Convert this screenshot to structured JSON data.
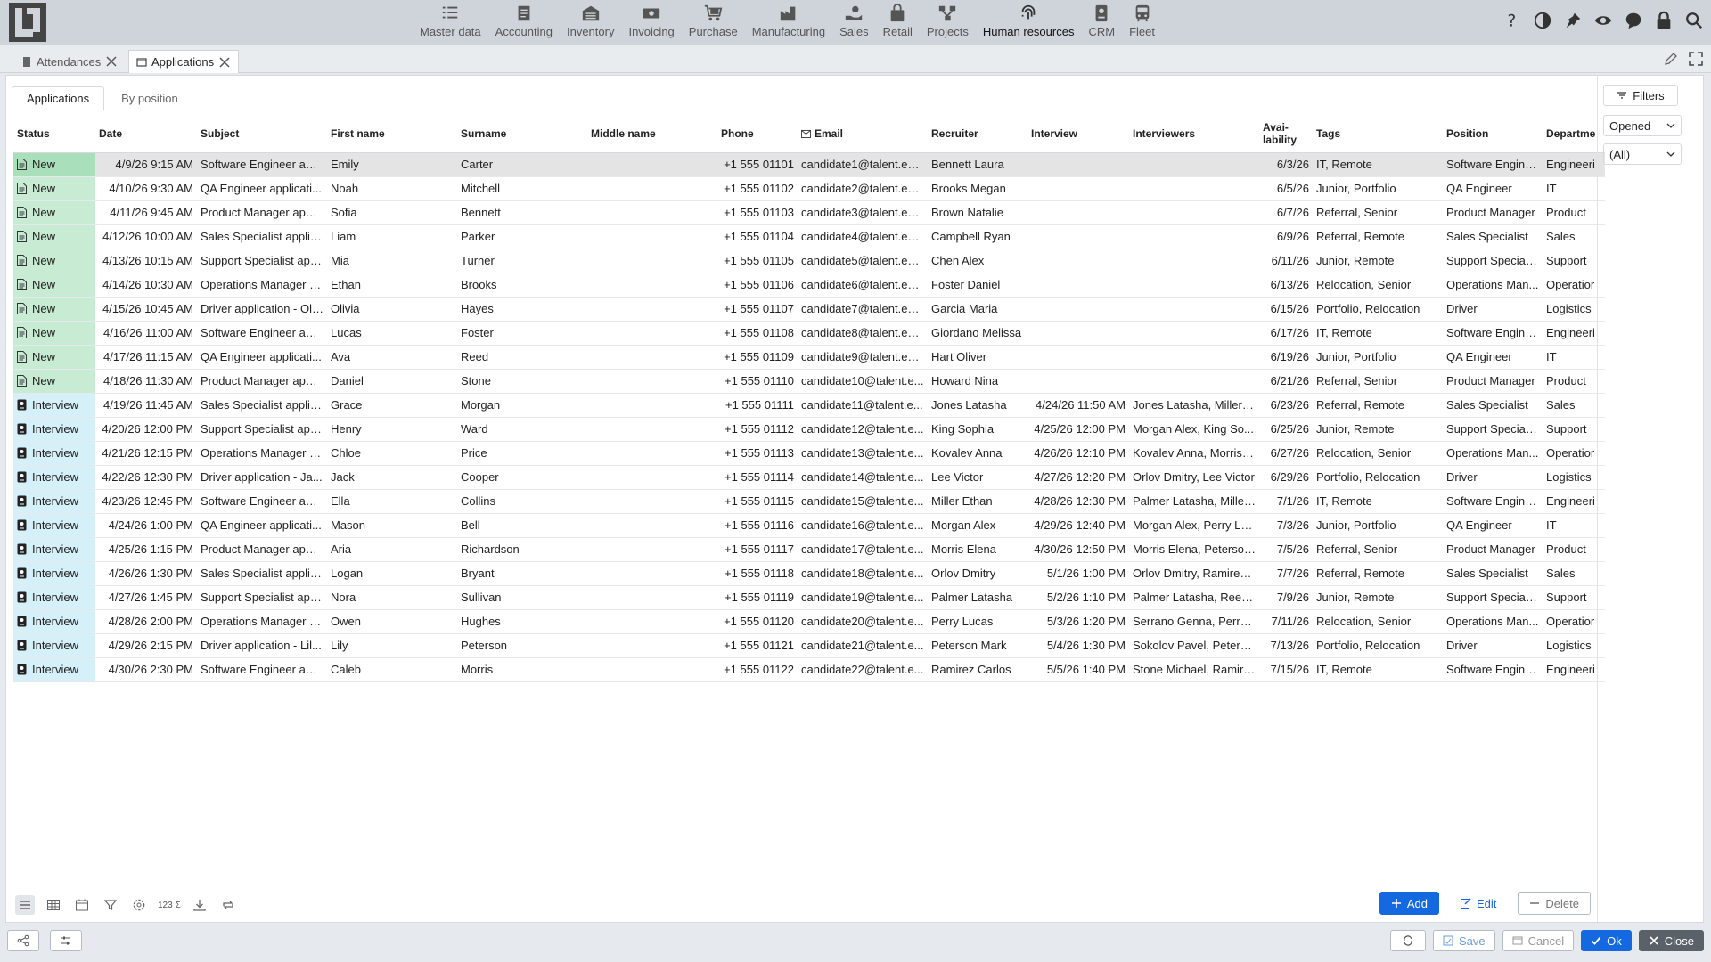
{
  "nav": {
    "items": [
      {
        "label": "Master data",
        "icon": "list-icon"
      },
      {
        "label": "Accounting",
        "icon": "document-icon"
      },
      {
        "label": "Inventory",
        "icon": "warehouse-icon"
      },
      {
        "label": "Invoicing",
        "icon": "money-icon"
      },
      {
        "label": "Purchase",
        "icon": "cart-icon"
      },
      {
        "label": "Manufacturing",
        "icon": "factory-icon"
      },
      {
        "label": "Sales",
        "icon": "hand-coin-icon"
      },
      {
        "label": "Retail",
        "icon": "bag-icon"
      },
      {
        "label": "Projects",
        "icon": "network-icon"
      },
      {
        "label": "Human resources",
        "icon": "fingerprint-icon"
      },
      {
        "label": "CRM",
        "icon": "badge-icon"
      },
      {
        "label": "Fleet",
        "icon": "bus-icon"
      }
    ],
    "active": "Human resources"
  },
  "tabs": {
    "attendances": "Attendances",
    "applications": "Applications"
  },
  "subtabs": {
    "applications": "Applications",
    "by_position": "By position"
  },
  "columns": {
    "status": "Status",
    "date": "Date",
    "subject": "Subject",
    "first_name": "First name",
    "surname": "Surname",
    "middle_name": "Middle name",
    "phone": "Phone",
    "email": "Email",
    "recruiter": "Recruiter",
    "interview": "Interview",
    "interviewers": "Interviewers",
    "availability": "Avai-lability",
    "tags": "Tags",
    "position": "Position",
    "department": "Departme"
  },
  "rows": [
    {
      "status": "New",
      "date": "4/9/26 9:15 AM",
      "subject": "Software Engineer app...",
      "first": "Emily",
      "surname": "Carter",
      "middle": "",
      "phone": "+1 555 01101",
      "email": "candidate1@talent.exa...",
      "recruiter": "Bennett Laura",
      "interview": "",
      "interviewers": "",
      "avail": "6/3/26",
      "tags": "IT, Remote",
      "position": "Software Engineer",
      "dept": "Engineeri"
    },
    {
      "status": "New",
      "date": "4/10/26 9:30 AM",
      "subject": "QA Engineer applicati...",
      "first": "Noah",
      "surname": "Mitchell",
      "middle": "",
      "phone": "+1 555 01102",
      "email": "candidate2@talent.exa...",
      "recruiter": "Brooks Megan",
      "interview": "",
      "interviewers": "",
      "avail": "6/5/26",
      "tags": "Junior, Portfolio",
      "position": "QA Engineer",
      "dept": "IT"
    },
    {
      "status": "New",
      "date": "4/11/26 9:45 AM",
      "subject": "Product Manager appl...",
      "first": "Sofia",
      "surname": "Bennett",
      "middle": "",
      "phone": "+1 555 01103",
      "email": "candidate3@talent.exa...",
      "recruiter": "Brown Natalie",
      "interview": "",
      "interviewers": "",
      "avail": "6/7/26",
      "tags": "Referral, Senior",
      "position": "Product Manager",
      "dept": "Product"
    },
    {
      "status": "New",
      "date": "4/12/26 10:00 AM",
      "subject": "Sales Specialist applica...",
      "first": "Liam",
      "surname": "Parker",
      "middle": "",
      "phone": "+1 555 01104",
      "email": "candidate4@talent.exa...",
      "recruiter": "Campbell Ryan",
      "interview": "",
      "interviewers": "",
      "avail": "6/9/26",
      "tags": "Referral, Remote",
      "position": "Sales Specialist",
      "dept": "Sales"
    },
    {
      "status": "New",
      "date": "4/13/26 10:15 AM",
      "subject": "Support Specialist app...",
      "first": "Mia",
      "surname": "Turner",
      "middle": "",
      "phone": "+1 555 01105",
      "email": "candidate5@talent.exa...",
      "recruiter": "Chen Alex",
      "interview": "",
      "interviewers": "",
      "avail": "6/11/26",
      "tags": "Junior, Remote",
      "position": "Support Specialist",
      "dept": "Support"
    },
    {
      "status": "New",
      "date": "4/14/26 10:30 AM",
      "subject": "Operations Manager a...",
      "first": "Ethan",
      "surname": "Brooks",
      "middle": "",
      "phone": "+1 555 01106",
      "email": "candidate6@talent.exa...",
      "recruiter": "Foster Daniel",
      "interview": "",
      "interviewers": "",
      "avail": "6/13/26",
      "tags": "Relocation, Senior",
      "position": "Operations Man...",
      "dept": "Operatior"
    },
    {
      "status": "New",
      "date": "4/15/26 10:45 AM",
      "subject": "Driver application - Oli...",
      "first": "Olivia",
      "surname": "Hayes",
      "middle": "",
      "phone": "+1 555 01107",
      "email": "candidate7@talent.exa...",
      "recruiter": "Garcia Maria",
      "interview": "",
      "interviewers": "",
      "avail": "6/15/26",
      "tags": "Portfolio, Relocation",
      "position": "Driver",
      "dept": "Logistics"
    },
    {
      "status": "New",
      "date": "4/16/26 11:00 AM",
      "subject": "Software Engineer app...",
      "first": "Lucas",
      "surname": "Foster",
      "middle": "",
      "phone": "+1 555 01108",
      "email": "candidate8@talent.exa...",
      "recruiter": "Giordano Melissa",
      "interview": "",
      "interviewers": "",
      "avail": "6/17/26",
      "tags": "IT, Remote",
      "position": "Software Engineer",
      "dept": "Engineeri"
    },
    {
      "status": "New",
      "date": "4/17/26 11:15 AM",
      "subject": "QA Engineer applicati...",
      "first": "Ava",
      "surname": "Reed",
      "middle": "",
      "phone": "+1 555 01109",
      "email": "candidate9@talent.exa...",
      "recruiter": "Hart Oliver",
      "interview": "",
      "interviewers": "",
      "avail": "6/19/26",
      "tags": "Junior, Portfolio",
      "position": "QA Engineer",
      "dept": "IT"
    },
    {
      "status": "New",
      "date": "4/18/26 11:30 AM",
      "subject": "Product Manager appl...",
      "first": "Daniel",
      "surname": "Stone",
      "middle": "",
      "phone": "+1 555 01110",
      "email": "candidate10@talent.e...",
      "recruiter": "Howard Nina",
      "interview": "",
      "interviewers": "",
      "avail": "6/21/26",
      "tags": "Referral, Senior",
      "position": "Product Manager",
      "dept": "Product"
    },
    {
      "status": "Interview",
      "date": "4/19/26 11:45 AM",
      "subject": "Sales Specialist applica...",
      "first": "Grace",
      "surname": "Morgan",
      "middle": "",
      "phone": "+1 555 01111",
      "email": "candidate11@talent.e...",
      "recruiter": "Jones Latasha",
      "interview": "4/24/26 11:50 AM",
      "interviewers": "Jones Latasha, Miller E...",
      "avail": "6/23/26",
      "tags": "Referral, Remote",
      "position": "Sales Specialist",
      "dept": "Sales"
    },
    {
      "status": "Interview",
      "date": "4/20/26 12:00 PM",
      "subject": "Support Specialist app...",
      "first": "Henry",
      "surname": "Ward",
      "middle": "",
      "phone": "+1 555 01112",
      "email": "candidate12@talent.e...",
      "recruiter": "King Sophia",
      "interview": "4/25/26 12:00 PM",
      "interviewers": "Morgan Alex, King So...",
      "avail": "6/25/26",
      "tags": "Junior, Remote",
      "position": "Support Specialist",
      "dept": "Support"
    },
    {
      "status": "Interview",
      "date": "4/21/26 12:15 PM",
      "subject": "Operations Manager a...",
      "first": "Chloe",
      "surname": "Price",
      "middle": "",
      "phone": "+1 555 01113",
      "email": "candidate13@talent.e...",
      "recruiter": "Kovalev Anna",
      "interview": "4/26/26 12:10 PM",
      "interviewers": "Kovalev Anna, Morris E...",
      "avail": "6/27/26",
      "tags": "Relocation, Senior",
      "position": "Operations Man...",
      "dept": "Operatior"
    },
    {
      "status": "Interview",
      "date": "4/22/26 12:30 PM",
      "subject": "Driver application - Ja...",
      "first": "Jack",
      "surname": "Cooper",
      "middle": "",
      "phone": "+1 555 01114",
      "email": "candidate14@talent.e...",
      "recruiter": "Lee Victor",
      "interview": "4/27/26 12:20 PM",
      "interviewers": "Orlov Dmitry, Lee Victor",
      "avail": "6/29/26",
      "tags": "Portfolio, Relocation",
      "position": "Driver",
      "dept": "Logistics"
    },
    {
      "status": "Interview",
      "date": "4/23/26 12:45 PM",
      "subject": "Software Engineer app...",
      "first": "Ella",
      "surname": "Collins",
      "middle": "",
      "phone": "+1 555 01115",
      "email": "candidate15@talent.e...",
      "recruiter": "Miller Ethan",
      "interview": "4/28/26 12:30 PM",
      "interviewers": "Palmer Latasha, Miller ...",
      "avail": "7/1/26",
      "tags": "IT, Remote",
      "position": "Software Engineer",
      "dept": "Engineeri"
    },
    {
      "status": "Interview",
      "date": "4/24/26 1:00 PM",
      "subject": "QA Engineer applicati...",
      "first": "Mason",
      "surname": "Bell",
      "middle": "",
      "phone": "+1 555 01116",
      "email": "candidate16@talent.e...",
      "recruiter": "Morgan Alex",
      "interview": "4/29/26 12:40 PM",
      "interviewers": "Morgan Alex, Perry Lu...",
      "avail": "7/3/26",
      "tags": "Junior, Portfolio",
      "position": "QA Engineer",
      "dept": "IT"
    },
    {
      "status": "Interview",
      "date": "4/25/26 1:15 PM",
      "subject": "Product Manager appl...",
      "first": "Aria",
      "surname": "Richardson",
      "middle": "",
      "phone": "+1 555 01117",
      "email": "candidate17@talent.e...",
      "recruiter": "Morris Elena",
      "interview": "4/30/26 12:50 PM",
      "interviewers": "Morris Elena, Peterson...",
      "avail": "7/5/26",
      "tags": "Referral, Senior",
      "position": "Product Manager",
      "dept": "Product"
    },
    {
      "status": "Interview",
      "date": "4/26/26 1:30 PM",
      "subject": "Sales Specialist applica...",
      "first": "Logan",
      "surname": "Bryant",
      "middle": "",
      "phone": "+1 555 01118",
      "email": "candidate18@talent.e...",
      "recruiter": "Orlov Dmitry",
      "interview": "5/1/26 1:00 PM",
      "interviewers": "Orlov Dmitry, Ramirez ...",
      "avail": "7/7/26",
      "tags": "Referral, Remote",
      "position": "Sales Specialist",
      "dept": "Sales"
    },
    {
      "status": "Interview",
      "date": "4/27/26 1:45 PM",
      "subject": "Support Specialist app...",
      "first": "Nora",
      "surname": "Sullivan",
      "middle": "",
      "phone": "+1 555 01119",
      "email": "candidate19@talent.e...",
      "recruiter": "Palmer Latasha",
      "interview": "5/2/26 1:10 PM",
      "interviewers": "Palmer Latasha, Reed T...",
      "avail": "7/9/26",
      "tags": "Junior, Remote",
      "position": "Support Specialist",
      "dept": "Support"
    },
    {
      "status": "Interview",
      "date": "4/28/26 2:00 PM",
      "subject": "Operations Manager a...",
      "first": "Owen",
      "surname": "Hughes",
      "middle": "",
      "phone": "+1 555 01120",
      "email": "candidate20@talent.e...",
      "recruiter": "Perry Lucas",
      "interview": "5/3/26 1:20 PM",
      "interviewers": "Serrano Genna, Perry L...",
      "avail": "7/11/26",
      "tags": "Relocation, Senior",
      "position": "Operations Man...",
      "dept": "Operatior"
    },
    {
      "status": "Interview",
      "date": "4/29/26 2:15 PM",
      "subject": "Driver application - Lil...",
      "first": "Lily",
      "surname": "Peterson",
      "middle": "",
      "phone": "+1 555 01121",
      "email": "candidate21@talent.e...",
      "recruiter": "Peterson Mark",
      "interview": "5/4/26 1:30 PM",
      "interviewers": "Sokolov Pavel, Peterso...",
      "avail": "7/13/26",
      "tags": "Portfolio, Relocation",
      "position": "Driver",
      "dept": "Logistics"
    },
    {
      "status": "Interview",
      "date": "4/30/26 2:30 PM",
      "subject": "Software Engineer app...",
      "first": "Caleb",
      "surname": "Morris",
      "middle": "",
      "phone": "+1 555 01122",
      "email": "candidate22@talent.e...",
      "recruiter": "Ramirez Carlos",
      "interview": "5/5/26 1:40 PM",
      "interviewers": "Stone Michael, Ramire...",
      "avail": "7/15/26",
      "tags": "IT, Remote",
      "position": "Software Engineer",
      "dept": "Engineeri"
    }
  ],
  "filters": {
    "title": "Filters",
    "status_value": "Opened",
    "scope_value": "(All)"
  },
  "toolbar": {
    "sum_label": "123 Σ"
  },
  "actions": {
    "add": "Add",
    "edit": "Edit",
    "delete": "Delete"
  },
  "footer": {
    "save": "Save",
    "cancel": "Cancel",
    "ok": "Ok",
    "close": "Close"
  },
  "colors": {
    "accent": "#1468e0",
    "status_new": "#c8ecd3",
    "status_interview": "#d6f0fa",
    "topbar": "#ced4da"
  }
}
